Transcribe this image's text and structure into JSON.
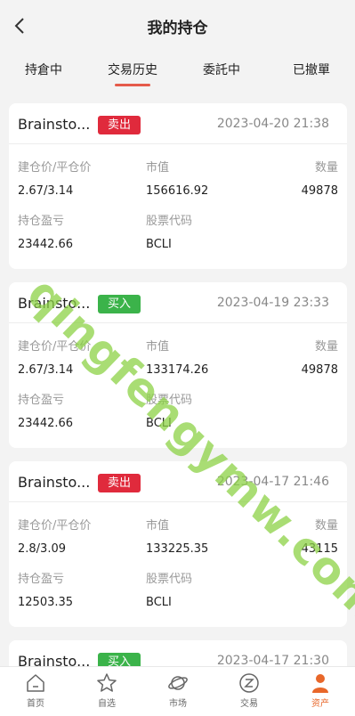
{
  "header": {
    "title": "我的持仓"
  },
  "tabs": [
    "持倉中",
    "交易历史",
    "委託中",
    "已撤單"
  ],
  "labels": {
    "cost_price": "建仓价/平仓价",
    "market_value": "市值",
    "quantity": "数量",
    "pnl": "持仓盈亏",
    "stock_code": "股票代码"
  },
  "trades": [
    {
      "name": "Brainsto...",
      "side": "卖出",
      "side_type": "sell",
      "time": "2023-04-20 21:38",
      "price": "2.67/3.14",
      "market_value": "156616.92",
      "quantity": "49878",
      "pnl": "23442.66",
      "code": "BCLI"
    },
    {
      "name": "Brainsto...",
      "side": "买入",
      "side_type": "buy",
      "time": "2023-04-19 23:33",
      "price": "2.67/3.14",
      "market_value": "133174.26",
      "quantity": "49878",
      "pnl": "23442.66",
      "code": "BCLI"
    },
    {
      "name": "Brainsto...",
      "side": "卖出",
      "side_type": "sell",
      "time": "2023-04-17 21:46",
      "price": "2.8/3.09",
      "market_value": "133225.35",
      "quantity": "43115",
      "pnl": "12503.35",
      "code": "BCLI"
    },
    {
      "name": "Brainsto...",
      "side": "买入",
      "side_type": "buy",
      "time": "2023-04-17 21:30"
    }
  ],
  "watermark": "qingfengymw.com",
  "tabbar": [
    {
      "label": "首页",
      "icon": "home-icon"
    },
    {
      "label": "自选",
      "icon": "star-icon"
    },
    {
      "label": "市场",
      "icon": "planet-icon"
    },
    {
      "label": "交易",
      "icon": "exchange-icon"
    },
    {
      "label": "资产",
      "icon": "user-icon"
    }
  ],
  "colors": {
    "sell": "#e02a3c",
    "buy": "#3bb34a",
    "accent": "#e8672a",
    "tab_underline": "#e55a4a"
  }
}
